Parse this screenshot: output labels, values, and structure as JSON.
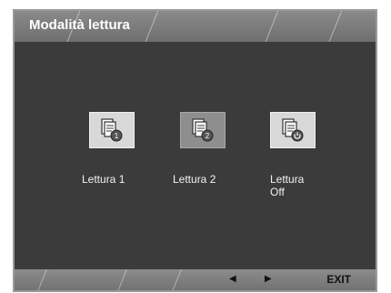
{
  "title": "Modalità lettura",
  "modes": [
    {
      "label": "Lettura 1",
      "badge": "1",
      "icon": "document-1-icon"
    },
    {
      "label": "Lettura 2",
      "badge": "2",
      "icon": "document-2-icon"
    },
    {
      "label_line1": "Lettura",
      "label_line2": "Off",
      "icon": "document-power-icon"
    }
  ],
  "selected_mode": "Lettura 2",
  "footer": {
    "left_arrow": "◀",
    "right_arrow": "▶",
    "exit_label": "EXIT"
  },
  "colors": {
    "panel": "#3b3b3b",
    "title_bar": "#7c7c7c",
    "icon_bg": "#d8d8d8",
    "icon_bg_selected": "#8e8e8e"
  }
}
